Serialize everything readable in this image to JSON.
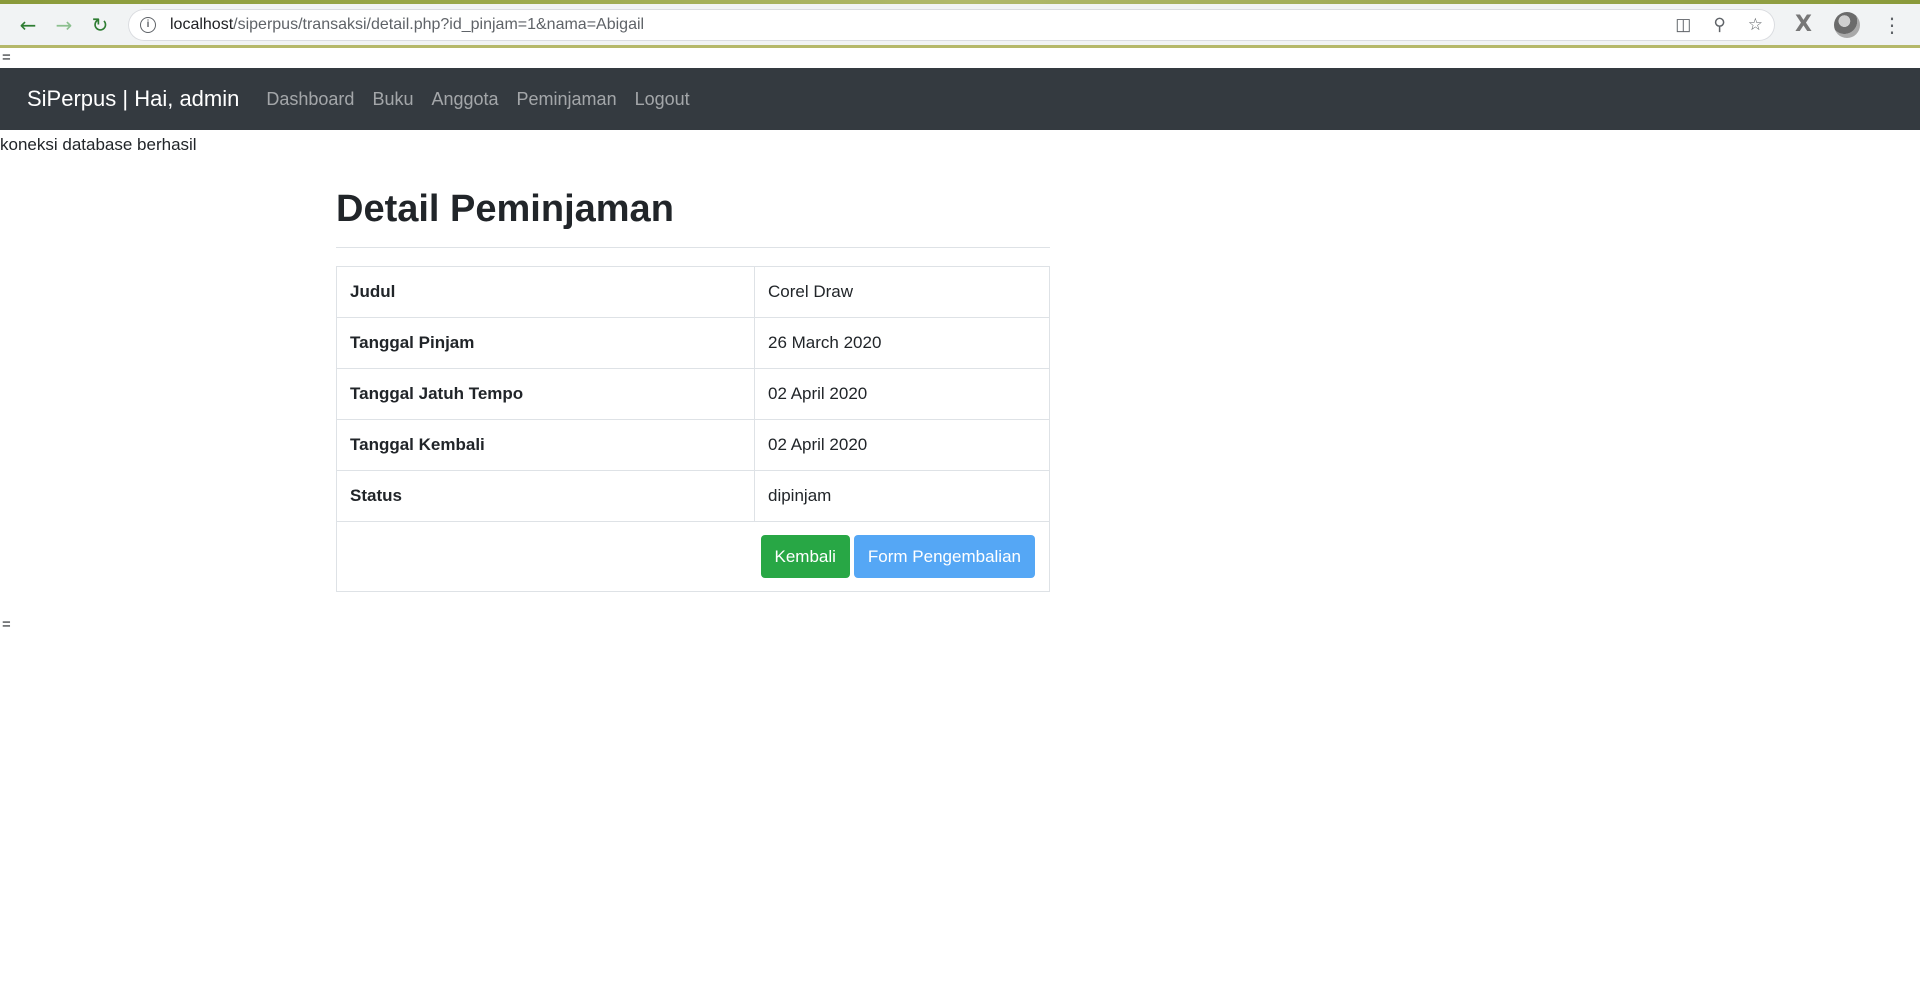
{
  "browser": {
    "url_host": "localhost",
    "url_path": "/siperpus/transaksi/detail.php?id_pinjam=1&nama=Abigail"
  },
  "page": {
    "stray_top": "=",
    "stray_bottom": "=",
    "db_message": "koneksi database berhasil"
  },
  "navbar": {
    "brand": "SiPerpus | Hai, admin",
    "links": [
      "Dashboard",
      "Buku",
      "Anggota",
      "Peminjaman",
      "Logout"
    ]
  },
  "detail": {
    "title": "Detail Peminjaman",
    "rows": [
      {
        "label": "Judul",
        "value": "Corel Draw"
      },
      {
        "label": "Tanggal Pinjam",
        "value": "26 March 2020"
      },
      {
        "label": "Tanggal Jatuh Tempo",
        "value": "02 April 2020"
      },
      {
        "label": "Tanggal Kembali",
        "value": "02 April 2020"
      },
      {
        "label": "Status",
        "value": "dipinjam"
      }
    ],
    "buttons": {
      "back": "Kembali",
      "return_form": "Form Pengembalian"
    }
  }
}
